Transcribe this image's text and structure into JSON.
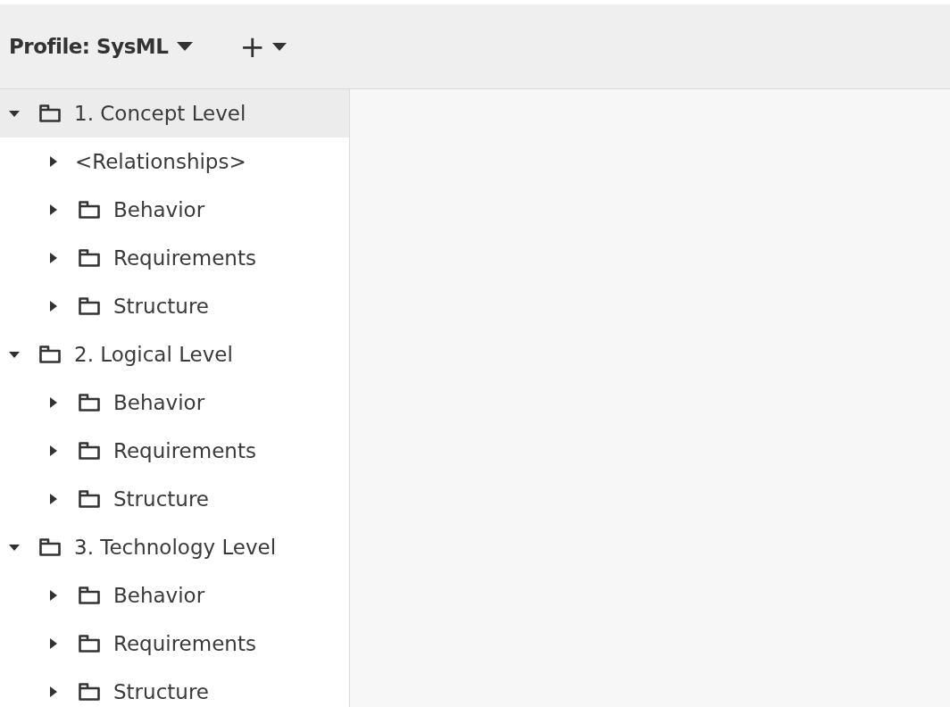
{
  "toolbar": {
    "profile_label": "Profile: SysML",
    "add_button": "+"
  },
  "tree": [
    {
      "label": "1. Concept Level",
      "kind": "folder",
      "expanded": true,
      "selected": true,
      "children": [
        {
          "label": "<Relationships>",
          "kind": "group",
          "expanded": false,
          "selected": false
        },
        {
          "label": "Behavior",
          "kind": "folder",
          "expanded": false,
          "selected": false
        },
        {
          "label": "Requirements",
          "kind": "folder",
          "expanded": false,
          "selected": false
        },
        {
          "label": "Structure",
          "kind": "folder",
          "expanded": false,
          "selected": false
        }
      ]
    },
    {
      "label": "2. Logical Level",
      "kind": "folder",
      "expanded": true,
      "selected": false,
      "children": [
        {
          "label": "Behavior",
          "kind": "folder",
          "expanded": false,
          "selected": false
        },
        {
          "label": "Requirements",
          "kind": "folder",
          "expanded": false,
          "selected": false
        },
        {
          "label": "Structure",
          "kind": "folder",
          "expanded": false,
          "selected": false
        }
      ]
    },
    {
      "label": "3. Technology Level",
      "kind": "folder",
      "expanded": true,
      "selected": false,
      "children": [
        {
          "label": "Behavior",
          "kind": "folder",
          "expanded": false,
          "selected": false
        },
        {
          "label": "Requirements",
          "kind": "folder",
          "expanded": false,
          "selected": false
        },
        {
          "label": "Structure",
          "kind": "folder",
          "expanded": false,
          "selected": false
        }
      ]
    }
  ]
}
